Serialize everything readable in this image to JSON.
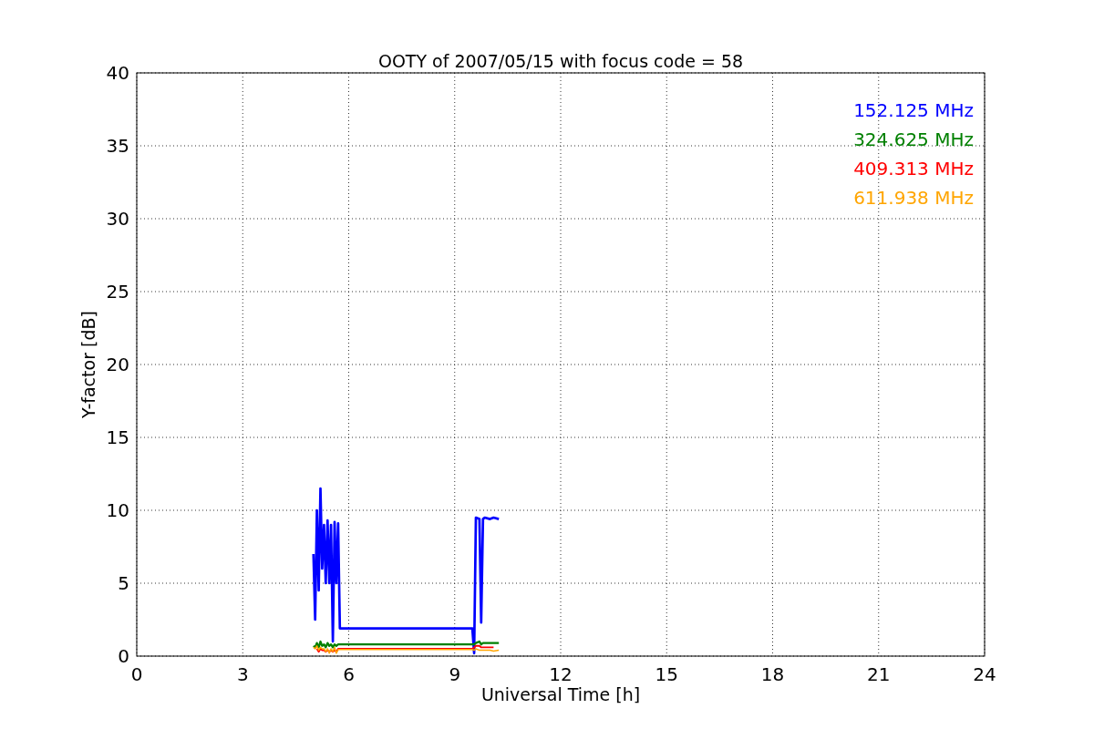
{
  "chart_data": {
    "type": "line",
    "title": "OOTY of 2007/05/15 with focus code = 58",
    "xlabel": "Universal Time [h]",
    "ylabel": "Y-factor [dB]",
    "x": [
      5.0,
      5.05,
      5.1,
      5.15,
      5.2,
      5.25,
      5.3,
      5.35,
      5.4,
      5.45,
      5.5,
      5.55,
      5.6,
      5.65,
      5.7,
      5.75,
      9.5,
      9.55,
      9.6,
      9.7,
      9.75,
      9.8,
      9.85,
      10.0,
      10.1,
      10.25
    ],
    "series": [
      {
        "name": "152.125 MHz",
        "color": "#0000ff",
        "values": [
          7,
          2.5,
          10,
          4.5,
          11.5,
          6,
          9,
          5,
          9.3,
          5,
          9,
          1.0,
          9.2,
          5,
          9.1,
          1.9,
          1.9,
          0.2,
          9.5,
          9.4,
          2.3,
          9.4,
          9.5,
          9.4,
          9.5,
          9.4
        ]
      },
      {
        "name": "324.625 MHz",
        "color": "#008000",
        "values": [
          0.7,
          0.6,
          0.9,
          0.6,
          1.0,
          0.7,
          0.8,
          0.6,
          0.9,
          0.7,
          0.8,
          0.6,
          0.8,
          0.7,
          0.8,
          0.8,
          0.8,
          0.8,
          0.9,
          1.0,
          0.8,
          0.9,
          0.9,
          0.9,
          0.9,
          0.9
        ]
      },
      {
        "name": "409.313 MHz",
        "color": "#ff0000",
        "values": [
          null,
          null,
          0.5,
          0.3,
          0.5,
          0.4,
          0.4,
          0.3,
          0.4,
          0.3,
          0.4,
          0.3,
          0.4,
          0.3,
          0.5,
          0.5,
          0.5,
          0.6,
          0.7,
          0.7,
          0.6,
          0.6,
          0.6,
          0.6,
          0.6,
          null
        ]
      },
      {
        "name": "611.938 MHz",
        "color": "#ffa500",
        "values": [
          0.6,
          0.5,
          0.7,
          0.4,
          0.6,
          0.5,
          0.5,
          0.3,
          0.5,
          0.2,
          0.5,
          0.3,
          0.6,
          0.2,
          0.45,
          0.45,
          0.45,
          0.4,
          0.5,
          0.4,
          0.4,
          0.4,
          0.4,
          0.4,
          0.35,
          0.4
        ]
      }
    ],
    "grid": true,
    "xlim": [
      0,
      24
    ],
    "ylim": [
      0,
      40
    ],
    "xticks": [
      0,
      3,
      6,
      9,
      12,
      15,
      18,
      21,
      24
    ],
    "yticks": [
      0,
      5,
      10,
      15,
      20,
      25,
      30,
      35,
      40
    ]
  }
}
